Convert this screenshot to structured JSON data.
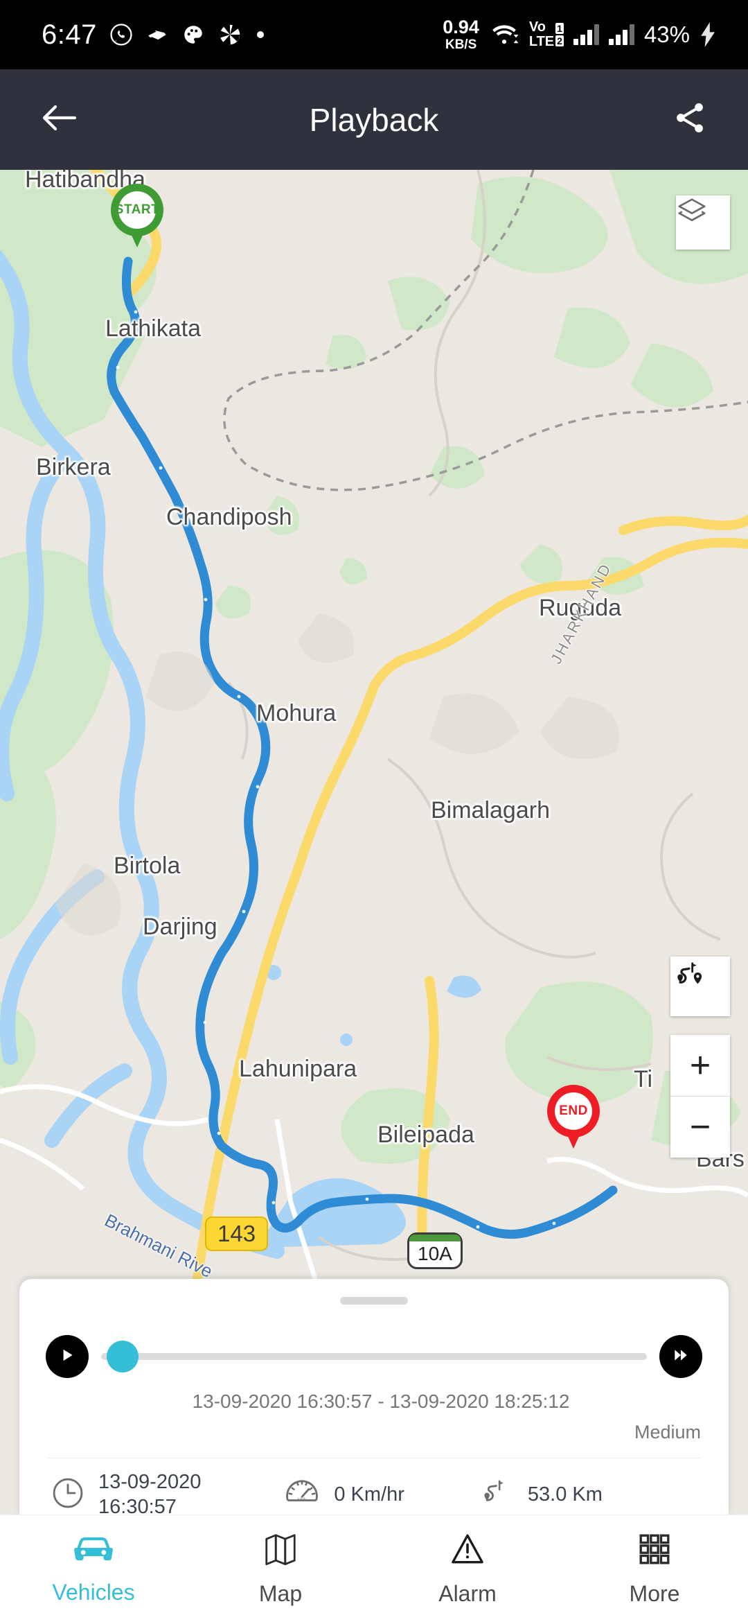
{
  "status_bar": {
    "time": "6:47",
    "icons": [
      "whatsapp-icon",
      "package-icon",
      "palette-icon",
      "camera-shutter-icon",
      "dot-icon"
    ],
    "net_speed_value": "0.94",
    "net_speed_unit": "KB/S",
    "wifi_icon": "wifi-icon",
    "volte_line1": "Vo",
    "volte_line2": "LTE",
    "sim1": "1",
    "sim2": "2",
    "battery": "43%",
    "charging_icon": "charging-bolt-icon"
  },
  "app_bar": {
    "back_icon": "back-arrow-icon",
    "title": "Playback",
    "share_icon": "share-icon"
  },
  "map": {
    "labels": [
      {
        "text": "Hatibandha"
      },
      {
        "text": "Lathikata"
      },
      {
        "text": "Birkera"
      },
      {
        "text": "Chandiposh"
      },
      {
        "text": "Ruguda"
      },
      {
        "text": "Mohura"
      },
      {
        "text": "Bimalagarh"
      },
      {
        "text": "Birtola"
      },
      {
        "text": "Darjing"
      },
      {
        "text": "Lahunipara"
      },
      {
        "text": "Bileipada"
      },
      {
        "text": "Ti"
      },
      {
        "text": "Bars"
      }
    ],
    "state_label": "JHARKHAND",
    "river_label": "Brahmani Rive",
    "shield_143": "143",
    "shield_10a": "10A",
    "start_marker": "START",
    "end_marker": "END",
    "layers_icon": "layers-icon",
    "route_icon": "route-overview-icon",
    "zoom_in": "+",
    "zoom_out": "−",
    "track_color": "#2e8bd4",
    "accent_color": "#35bfd6"
  },
  "playback": {
    "play_icon": "play-icon",
    "forward_icon": "fast-forward-icon",
    "progress_percent": 0,
    "time_range": "13-09-2020 16:30:57 - 13-09-2020 18:25:12",
    "speed_label": "Medium"
  },
  "stats": {
    "clock_icon": "clock-icon",
    "datetime_line1": "13-09-2020",
    "datetime_line2": "16:30:57",
    "speed_icon": "speedometer-icon",
    "speed_value": "0 Km/hr",
    "distance_icon": "route-distance-icon",
    "distance_value": "53.0 Km"
  },
  "bottom_nav": {
    "items": [
      {
        "label": "Vehicles",
        "icon": "car-icon",
        "active": true
      },
      {
        "label": "Map",
        "icon": "map-icon",
        "active": false
      },
      {
        "label": "Alarm",
        "icon": "alarm-warning-icon",
        "active": false
      },
      {
        "label": "More",
        "icon": "grid-more-icon",
        "active": false
      }
    ]
  }
}
